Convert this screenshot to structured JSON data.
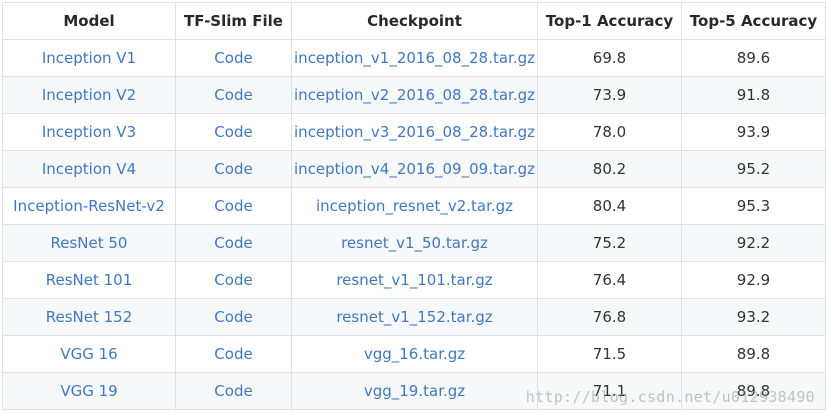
{
  "table": {
    "headers": [
      "Model",
      "TF-Slim File",
      "Checkpoint",
      "Top-1 Accuracy",
      "Top-5 Accuracy"
    ],
    "rows": [
      {
        "model": "Inception V1",
        "file": "Code",
        "checkpoint": "inception_v1_2016_08_28.tar.gz",
        "top1": "69.8",
        "top5": "89.6"
      },
      {
        "model": "Inception V2",
        "file": "Code",
        "checkpoint": "inception_v2_2016_08_28.tar.gz",
        "top1": "73.9",
        "top5": "91.8"
      },
      {
        "model": "Inception V3",
        "file": "Code",
        "checkpoint": "inception_v3_2016_08_28.tar.gz",
        "top1": "78.0",
        "top5": "93.9"
      },
      {
        "model": "Inception V4",
        "file": "Code",
        "checkpoint": "inception_v4_2016_09_09.tar.gz",
        "top1": "80.2",
        "top5": "95.2"
      },
      {
        "model": "Inception-ResNet-v2",
        "file": "Code",
        "checkpoint": "inception_resnet_v2.tar.gz",
        "top1": "80.4",
        "top5": "95.3"
      },
      {
        "model": "ResNet 50",
        "file": "Code",
        "checkpoint": "resnet_v1_50.tar.gz",
        "top1": "75.2",
        "top5": "92.2"
      },
      {
        "model": "ResNet 101",
        "file": "Code",
        "checkpoint": "resnet_v1_101.tar.gz",
        "top1": "76.4",
        "top5": "92.9"
      },
      {
        "model": "ResNet 152",
        "file": "Code",
        "checkpoint": "resnet_v1_152.tar.gz",
        "top1": "76.8",
        "top5": "93.2"
      },
      {
        "model": "VGG 16",
        "file": "Code",
        "checkpoint": "vgg_16.tar.gz",
        "top1": "71.5",
        "top5": "89.8"
      },
      {
        "model": "VGG 19",
        "file": "Code",
        "checkpoint": "vgg_19.tar.gz",
        "top1": "71.1",
        "top5": "89.8"
      }
    ]
  },
  "watermark": "http://blog.csdn.net/u012938490",
  "colors": {
    "link": "#4078c0",
    "header_text": "#24292e",
    "stripe": "#f6f8fa",
    "border": "#dfe2e5"
  }
}
